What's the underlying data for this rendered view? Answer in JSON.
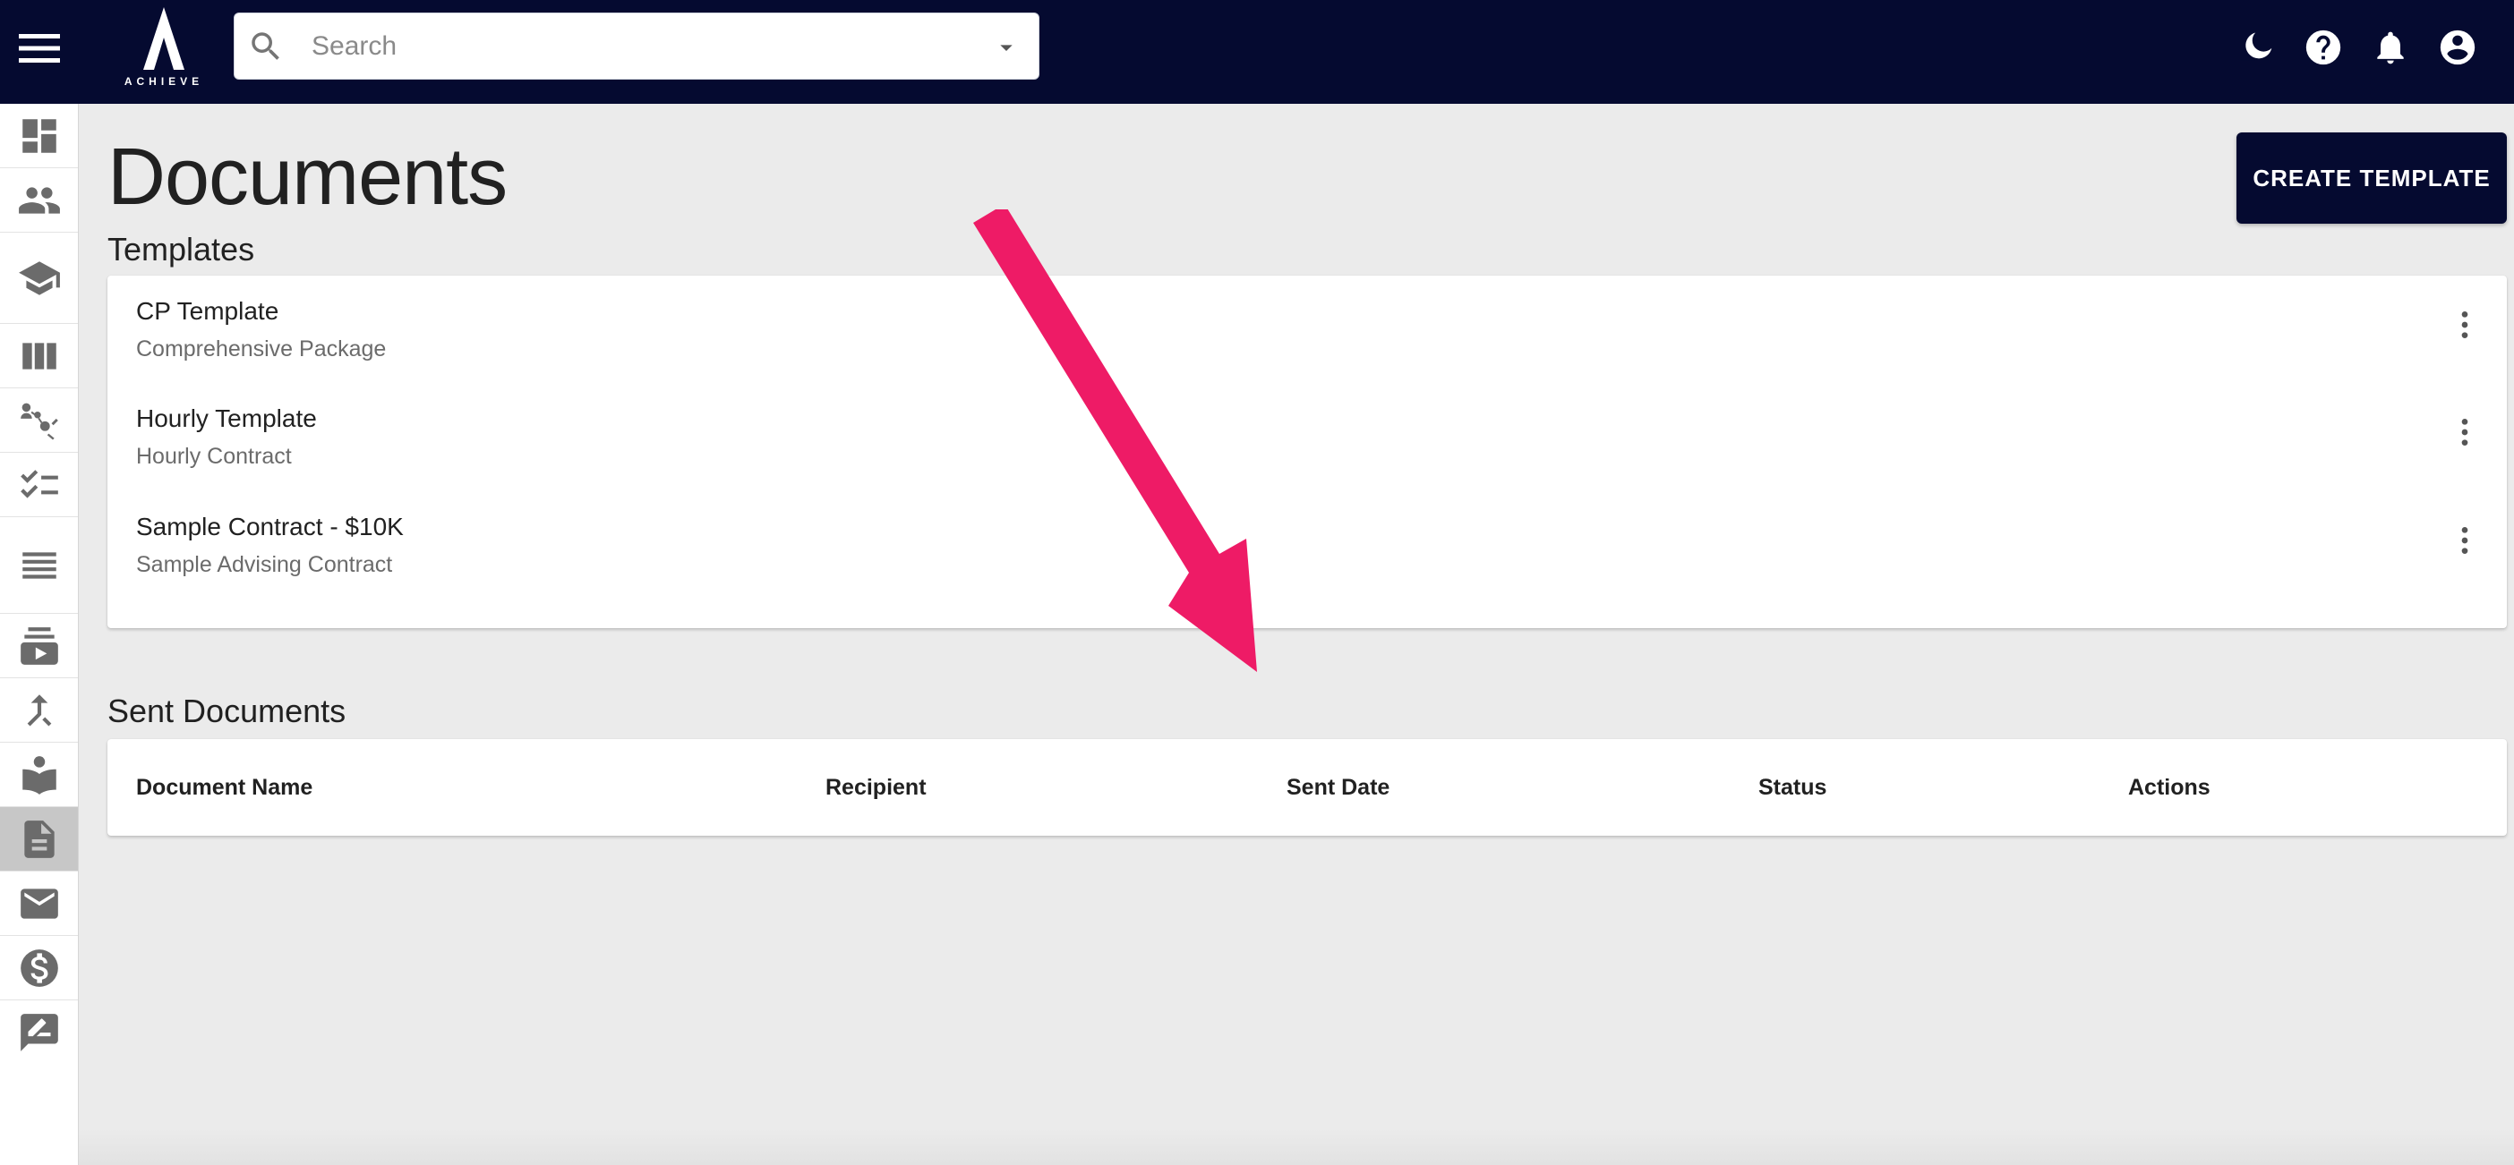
{
  "app": {
    "logo_text": "ACHIEVE",
    "search_placeholder": "Search"
  },
  "header_icons": [
    "theme-toggle-icon",
    "help-icon",
    "notifications-icon",
    "account-icon"
  ],
  "sidebar": {
    "items": [
      {
        "icon": "dashboard-icon",
        "active": false
      },
      {
        "icon": "people-icon",
        "active": false
      },
      {
        "icon": "school-icon",
        "active": false
      },
      {
        "icon": "view-column-icon",
        "active": false
      },
      {
        "icon": "connections-icon",
        "active": false
      },
      {
        "icon": "checklist-icon",
        "active": false
      },
      {
        "icon": "list-icon",
        "active": false
      },
      {
        "icon": "subscriptions-icon",
        "active": false
      },
      {
        "icon": "merge-icon",
        "active": false
      },
      {
        "icon": "reading-icon",
        "active": false
      },
      {
        "icon": "document-icon",
        "active": true
      },
      {
        "icon": "mail-icon",
        "active": false
      },
      {
        "icon": "dollar-icon",
        "active": false
      },
      {
        "icon": "feedback-icon",
        "active": false
      }
    ]
  },
  "page": {
    "title": "Documents",
    "create_button": "CREATE TEMPLATE"
  },
  "templates": {
    "title": "Templates",
    "items": [
      {
        "name": "CP Template",
        "description": "Comprehensive Package"
      },
      {
        "name": "Hourly Template",
        "description": "Hourly Contract"
      },
      {
        "name": "Sample Contract - $10K",
        "description": "Sample Advising Contract"
      }
    ]
  },
  "sent_documents": {
    "title": "Sent Documents",
    "columns": [
      "Document Name",
      "Recipient",
      "Sent Date",
      "Status",
      "Actions"
    ]
  },
  "colors": {
    "topbar": "#050a30",
    "background": "#ebebeb",
    "annotation_arrow": "#ee1b66"
  }
}
